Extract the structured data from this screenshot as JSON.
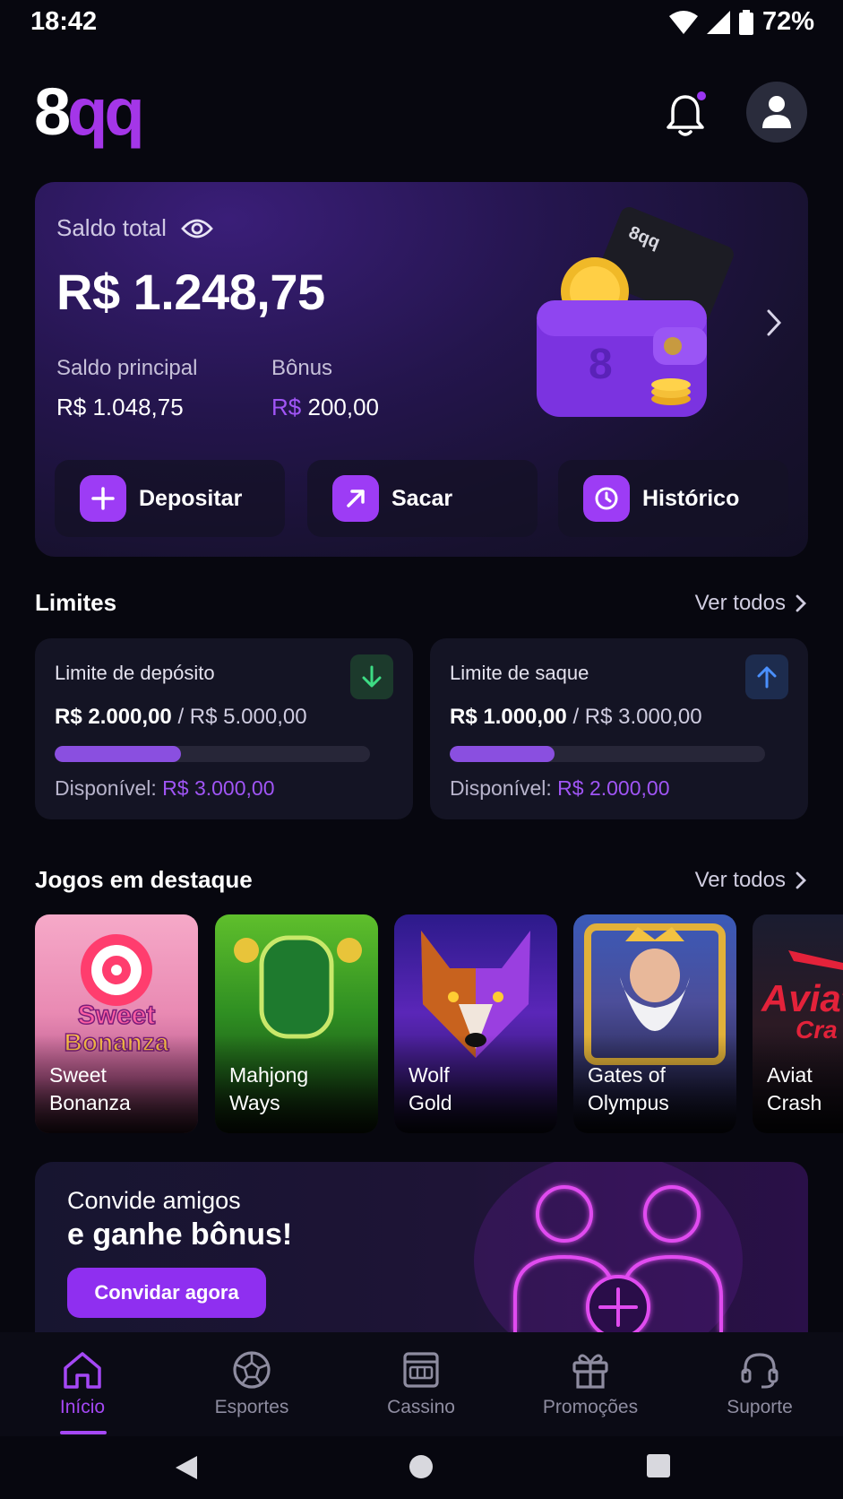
{
  "status": {
    "time": "18:42",
    "battery": "72%"
  },
  "header": {
    "logo_eight": "8",
    "logo_qq": "qq"
  },
  "balance": {
    "label": "Saldo total",
    "amount": "R$ 1.248,75",
    "principal_label": "Saldo principal",
    "principal_value": "R$ 1.048,75",
    "bonus_label": "Bônus",
    "bonus_currency": "R$",
    "bonus_value": "200,00",
    "card_logo": "8qq",
    "wallet_mark": "8"
  },
  "actions": [
    {
      "label": "Depositar",
      "icon": "plus-icon"
    },
    {
      "label": "Sacar",
      "icon": "arrow-up-right-icon"
    },
    {
      "label": "Histórico",
      "icon": "clock-icon"
    }
  ],
  "limits": {
    "title": "Limites",
    "see_all": "Ver todos",
    "items": [
      {
        "title": "Limite de depósito",
        "current": "R$ 2.000,00",
        "max": "/ R$ 5.000,00",
        "progress": 0.4,
        "available_label": "Disponível:",
        "available_value": "R$ 3.000,00",
        "icon": "arrow-down-icon",
        "color": "#3ddc84"
      },
      {
        "title": "Limite de saque",
        "current": "R$ 1.000,00",
        "max": "/ R$ 3.000,00",
        "progress": 0.333,
        "available_label": "Disponível:",
        "available_value": "R$ 2.000,00",
        "icon": "arrow-up-icon",
        "color": "#4a90ff"
      }
    ]
  },
  "games": {
    "title": "Jogos em destaque",
    "see_all": "Ver todos",
    "items": [
      {
        "name": "Sweet\nBonanza",
        "logo": "Sweet\nBonanza"
      },
      {
        "name": "Mahjong\nWays",
        "logo": ""
      },
      {
        "name": "Wolf\nGold",
        "logo": ""
      },
      {
        "name": "Gates of\nOlympus",
        "logo": ""
      },
      {
        "name": "Aviat\nCrash",
        "logo": "Aviat\nCra"
      }
    ]
  },
  "invite": {
    "line1": "Convide amigos",
    "line2": "e ganhe bônus!",
    "button": "Convidar agora"
  },
  "nav": [
    {
      "label": "Início",
      "icon": "home-icon",
      "active": true
    },
    {
      "label": "Esportes",
      "icon": "ball-icon",
      "active": false
    },
    {
      "label": "Cassino",
      "icon": "slot-machine-icon",
      "active": false
    },
    {
      "label": "Promoções",
      "icon": "gift-icon",
      "active": false
    },
    {
      "label": "Suporte",
      "icon": "headset-icon",
      "active": false
    }
  ],
  "colors": {
    "accent": "#9d3cf5",
    "background": "#07070f",
    "card": "#141424"
  }
}
